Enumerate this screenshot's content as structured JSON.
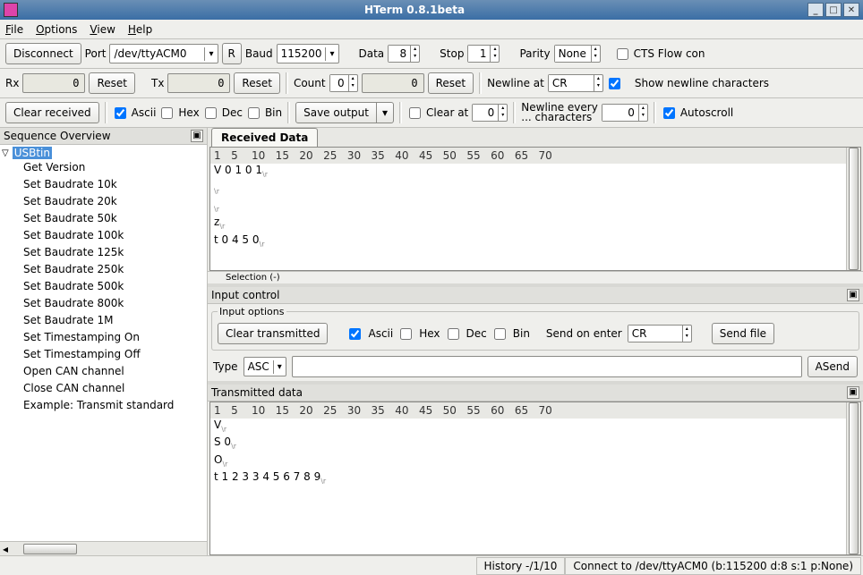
{
  "window": {
    "title": "HTerm 0.8.1beta"
  },
  "menu": {
    "file": "File",
    "options": "Options",
    "view": "View",
    "help": "Help"
  },
  "tb1": {
    "connect": "Disconnect",
    "port_label": "Port",
    "port": "/dev/ttyACM0",
    "r": "R",
    "baud_label": "Baud",
    "baud": "115200",
    "data_label": "Data",
    "data": "8",
    "stop_label": "Stop",
    "stop": "1",
    "parity_label": "Parity",
    "parity": "None",
    "cts": "CTS Flow con"
  },
  "tb2": {
    "rx_label": "Rx",
    "rx": "0",
    "rx_reset": "Reset",
    "tx_label": "Tx",
    "tx": "0",
    "tx_reset": "Reset",
    "count_label": "Count",
    "count": "0",
    "count_val": "0",
    "count_reset": "Reset",
    "newline_label": "Newline at",
    "newline": "CR",
    "shownl": "Show newline characters"
  },
  "tb3": {
    "clear": "Clear received",
    "ascii": "Ascii",
    "hex": "Hex",
    "dec": "Dec",
    "bin": "Bin",
    "save": "Save output",
    "clearat": "Clear at",
    "clearat_val": "0",
    "nlevery1": "Newline every",
    "nlevery2": "... characters",
    "nlevery_val": "0",
    "autoscroll": "Autoscroll"
  },
  "sidebar": {
    "title": "Sequence Overview",
    "root": "USBtin",
    "items": [
      "Get Version",
      "Set Baudrate 10k",
      "Set Baudrate 20k",
      "Set Baudrate 50k",
      "Set Baudrate 100k",
      "Set Baudrate 125k",
      "Set Baudrate 250k",
      "Set Baudrate 500k",
      "Set Baudrate 800k",
      "Set Baudrate 1M",
      "Set Timestamping On",
      "Set Timestamping Off",
      "Open CAN channel",
      "Close CAN channel",
      "Example: Transmit standard"
    ]
  },
  "received": {
    "tab": "Received Data",
    "ruler": "1   5    10   15   20   25   30   35   40   45   50   55   60   65   70",
    "lines": [
      "V0101",
      "",
      "",
      "z",
      "t0450"
    ],
    "selection": "Selection (-)"
  },
  "input": {
    "title": "Input control",
    "options": "Input options",
    "clear": "Clear transmitted",
    "ascii": "Ascii",
    "hex": "Hex",
    "dec": "Dec",
    "bin": "Bin",
    "sendon": "Send on enter",
    "sendon_val": "CR",
    "sendfile": "Send file",
    "type": "Type",
    "type_val": "ASC",
    "asend": "ASend"
  },
  "transmitted": {
    "title": "Transmitted data",
    "ruler": "1   5    10   15   20   25   30   35   40   45   50   55   60   65   70",
    "lines": [
      "V",
      "S0",
      "O",
      "t1233456789"
    ]
  },
  "status": {
    "history": "History -/1/10",
    "conn": "Connect to /dev/ttyACM0 (b:115200 d:8 s:1 p:None)"
  }
}
